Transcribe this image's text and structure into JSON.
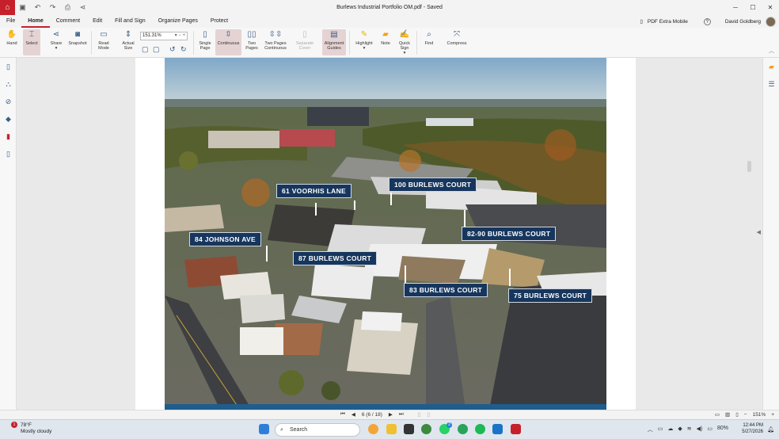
{
  "window": {
    "title": "Burlews Industrial Portfolio OM.pdf - Saved",
    "minimize": "─",
    "maximize": "☐",
    "close": "✕"
  },
  "menu": {
    "items": [
      "File",
      "Home",
      "Comment",
      "Edit",
      "Fill and Sign",
      "Organize Pages",
      "Protect"
    ],
    "active": "Home",
    "pdf_extra_mobile": "PDF Extra Mobile",
    "help": "?",
    "user": "David Goldberg"
  },
  "ribbon": {
    "hand": "Hand",
    "select": "Select",
    "share": "Share",
    "snapshot": "Snapshot",
    "read_mode": "Read Mode",
    "actual_size": "Actual Size",
    "zoom_value": "151.31%",
    "single_page": "Single Page",
    "continuous": "Continuous",
    "two_pages": "Two Pages",
    "two_pages_continuous": "Two Pages Continuous",
    "separate_cover": "Separate Cover",
    "alignment_guides": "Alignment Guides",
    "highlight": "Highlight",
    "note": "Note",
    "quick_sign": "Quick Sign",
    "find": "Find",
    "compress": "Compress"
  },
  "map_labels": {
    "voorhis": "61 VOORHIS LANE",
    "burlews100": "100 BURLEWS COURT",
    "johnson": "84 JOHNSON AVE",
    "burlews87": "87 BURLEWS COURT",
    "burlews8290": "82-90 BURLEWS COURT",
    "burlews83": "83 BURLEWS COURT",
    "burlews75": "75 BURLEWS COURT"
  },
  "statusbar": {
    "page_indicator": "6 (6 / 18)",
    "zoom": "151%"
  },
  "taskbar": {
    "temperature": "78°F",
    "weather": "Mostly cloudy",
    "weather_badge": "1",
    "search_placeholder": "Search",
    "battery": "80%",
    "time": "12:44 PM",
    "date": "5/27/2026",
    "whatsapp_badge": "2"
  },
  "colors": {
    "brand_red": "#c6202b",
    "label_navy": "#17365d",
    "ribbon_icon_blue": "#355a86"
  }
}
